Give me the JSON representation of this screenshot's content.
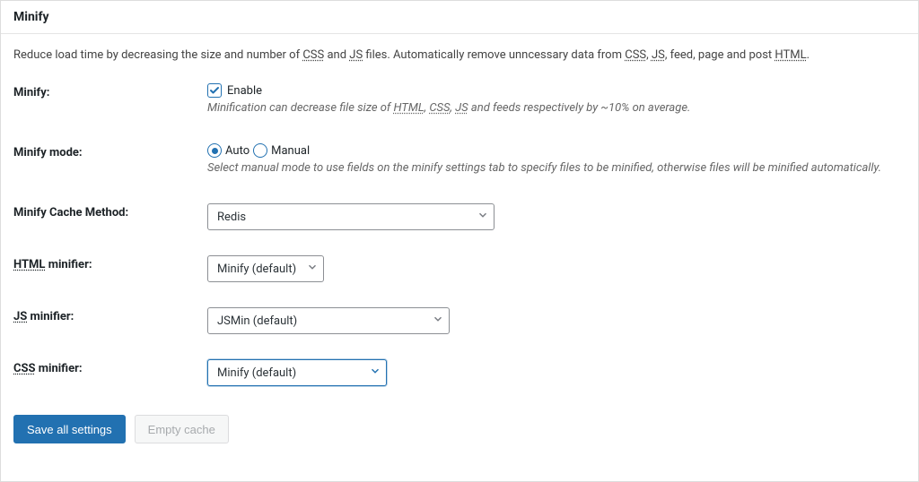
{
  "header": {
    "title": "Minify"
  },
  "description": {
    "part1": "Reduce load time by decreasing the size and number of ",
    "abbr1": "CSS",
    "part2": " and ",
    "abbr2": "JS",
    "part3": " files. Automatically remove unncessary data from ",
    "abbr3": "CSS",
    "part4": ", ",
    "abbr4": "JS",
    "part5": ", feed, page and post ",
    "abbr5": "HTML",
    "part6": "."
  },
  "minify": {
    "label": "Minify:",
    "enable_label": "Enable",
    "checked": true,
    "help_p1": "Minification can decrease file size of ",
    "help_a1": "HTML",
    "help_p2": ", ",
    "help_a2": "CSS",
    "help_p3": ", ",
    "help_a3": "JS",
    "help_p4": " and feeds respectively by ~10% on average."
  },
  "mode": {
    "label": "Minify mode:",
    "auto_label": "Auto",
    "manual_label": "Manual",
    "selected": "auto",
    "help": "Select manual mode to use fields on the minify settings tab to specify files to be minified, otherwise files will be minified automatically."
  },
  "cache_method": {
    "label": "Minify Cache Method:",
    "value": "Redis"
  },
  "html_minifier": {
    "abbr": "HTML",
    "label_suffix": " minifier:",
    "value": "Minify (default)"
  },
  "js_minifier": {
    "abbr": "JS",
    "label_suffix": " minifier:",
    "value": "JSMin (default)"
  },
  "css_minifier": {
    "abbr": "CSS",
    "label_suffix": " minifier:",
    "value": "Minify (default)"
  },
  "buttons": {
    "save": "Save all settings",
    "empty": "Empty cache"
  }
}
